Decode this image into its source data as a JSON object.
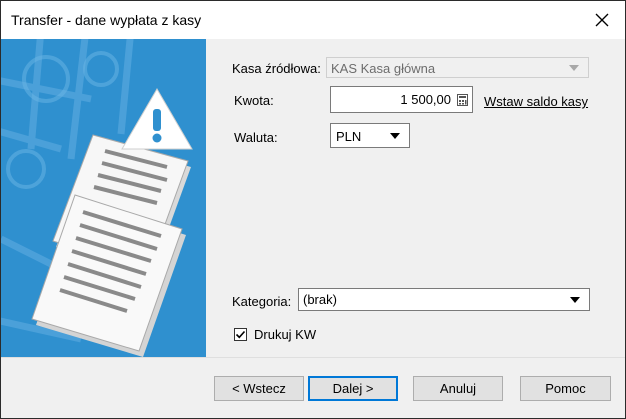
{
  "window": {
    "title": "Transfer - dane wypłata z kasy",
    "close_glyph": "✕"
  },
  "form": {
    "source_label": "Kasa źródłowa:",
    "source_value": "KAS Kasa główna",
    "amount_label": "Kwota:",
    "amount_value": "1 500,00",
    "insert_balance_link": "Wstaw saldo kasy",
    "currency_label": "Waluta:",
    "currency_value": "PLN",
    "category_label": "Kategoria:",
    "category_value": "(brak)",
    "print_kw_label": "Drukuj KW",
    "print_kw_checked": true
  },
  "buttons": {
    "back": "< Wstecz",
    "next": "Dalej >",
    "cancel": "Anuluj",
    "help": "Pomoc"
  },
  "colors": {
    "side_panel": "#2f90cf",
    "warning_triangle": "#ffffff",
    "focus_border": "#0078d7"
  },
  "icons": [
    "close-icon",
    "warning-icon",
    "documents-illustration",
    "calculator-icon",
    "dropdown-arrow-icon",
    "checkmark-icon"
  ]
}
